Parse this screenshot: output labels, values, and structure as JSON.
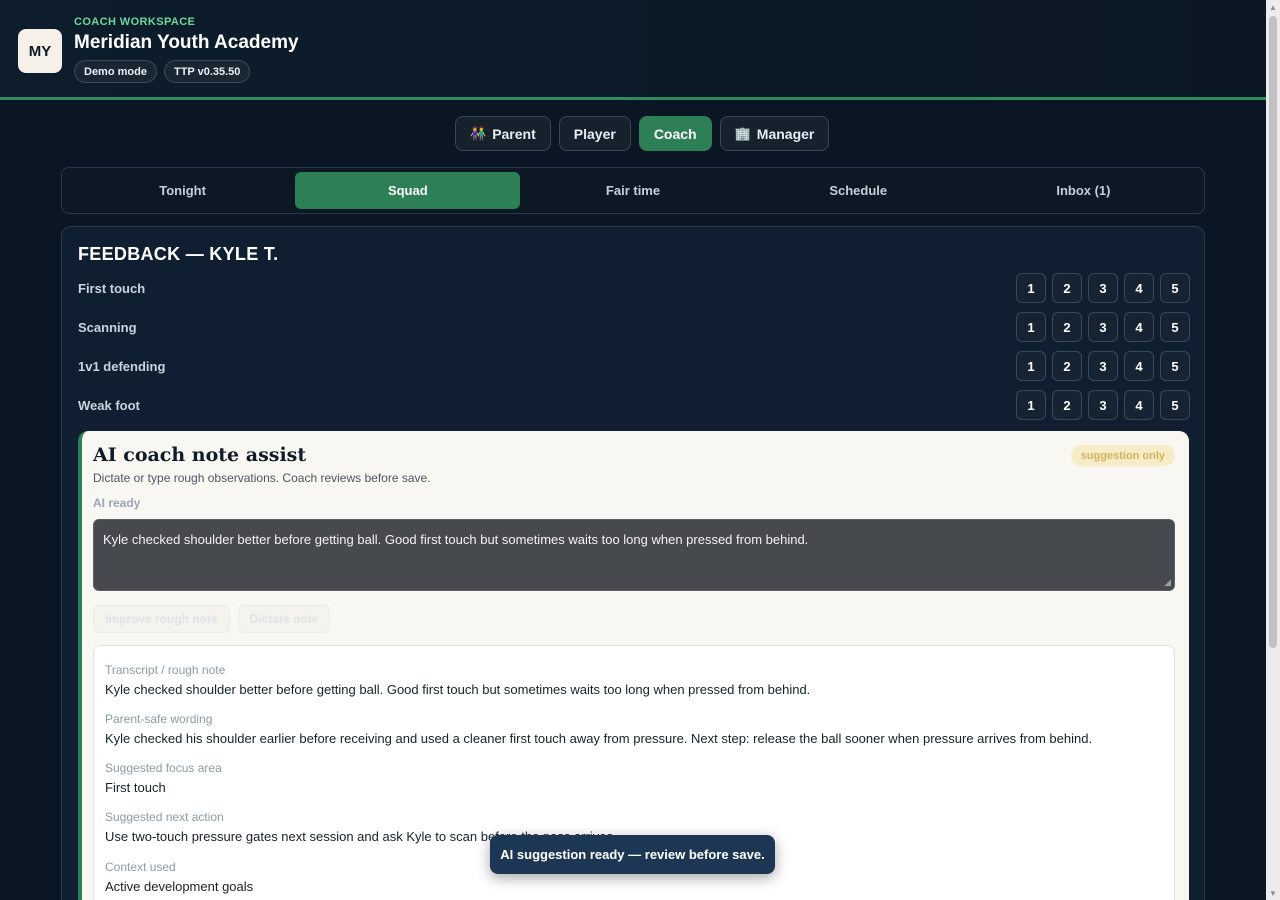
{
  "header": {
    "logo_initials": "MY",
    "eyebrow": "COACH WORKSPACE",
    "org_name": "Meridian Youth Academy",
    "badges": [
      "Demo mode",
      "TTP v0.35.50"
    ]
  },
  "roles": [
    {
      "label": "Parent",
      "icon": "people-icon",
      "active": false
    },
    {
      "label": "Player",
      "active": false
    },
    {
      "label": "Coach",
      "active": true
    },
    {
      "label": "Manager",
      "icon": "building-icon",
      "active": false
    }
  ],
  "tabs": [
    {
      "label": "Tonight",
      "active": false
    },
    {
      "label": "Squad",
      "active": true
    },
    {
      "label": "Fair time",
      "active": false
    },
    {
      "label": "Schedule",
      "active": false
    },
    {
      "label": "Inbox (1)",
      "active": false
    }
  ],
  "feedback": {
    "title": "FEEDBACK — KYLE T.",
    "scale": [
      "1",
      "2",
      "3",
      "4",
      "5"
    ],
    "skills": [
      "First touch",
      "Scanning",
      "1v1 defending",
      "Weak foot"
    ]
  },
  "ai_assist": {
    "title": "AI coach note assist",
    "pill": "suggestion only",
    "subtitle": "Dictate or type rough observations. Coach reviews before save.",
    "status": "AI ready",
    "note_value": "Kyle checked shoulder better before getting ball. Good first touch but sometimes waits too long when pressed from behind.",
    "improve_label": "Improve rough note",
    "dictate_label": "Dictate note",
    "results": [
      {
        "label": "Transcript / rough note",
        "value": "Kyle checked shoulder better before getting ball. Good first touch but sometimes waits too long when pressed from behind."
      },
      {
        "label": "Parent-safe wording",
        "value": "Kyle checked his shoulder earlier before receiving and used a cleaner first touch away from pressure. Next step: release the ball sooner when pressure arrives from behind."
      },
      {
        "label": "Suggested focus area",
        "value": "First touch"
      },
      {
        "label": "Suggested next action",
        "value": "Use two-touch pressure gates next session and ask Kyle to scan before the pass arrives."
      },
      {
        "label": "Context used",
        "value": "Active development goals"
      }
    ]
  },
  "toast": "AI suggestion ready — review before save.",
  "colors": {
    "accent": "#2d7f56",
    "eyebrow": "#6fd69b",
    "background": "#0a1624",
    "toast": "#1d3654"
  }
}
